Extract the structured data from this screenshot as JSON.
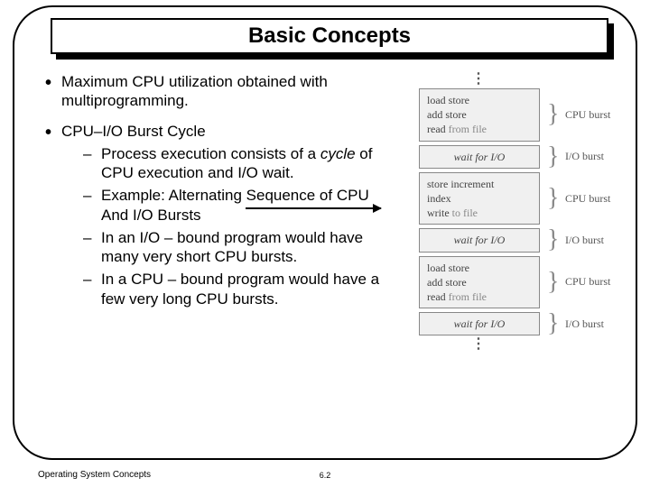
{
  "title": "Basic Concepts",
  "bullets": [
    {
      "text": "Maximum CPU utilization obtained with multiprogramming."
    },
    {
      "text": "CPU–I/O Burst Cycle",
      "sub": [
        {
          "pre": "Process execution consists of a ",
          "em": "cycle",
          "post": " of CPU execution and I/O wait."
        },
        {
          "pre": "Example: Alternating Sequence of CPU And I/O Bursts"
        },
        {
          "pre": "In an I/O – bound program would have many very short CPU bursts."
        },
        {
          "pre": "In a CPU – bound program would have a few very long CPU bursts."
        }
      ]
    }
  ],
  "diagram": {
    "vdots": "⋮",
    "cpu_label": "CPU burst",
    "io_label": "I/O burst",
    "wait": "wait for I/O",
    "block1": {
      "l1a": "load store",
      "l2a": "add store",
      "l3a": "read ",
      "l3b": "from file"
    },
    "block2": {
      "l1a": "store increment",
      "l2a": "index",
      "l3a": "write ",
      "l3b": "to file"
    },
    "block3": {
      "l1a": "load store",
      "l2a": "add store",
      "l3a": "read ",
      "l3b": "from file"
    }
  },
  "footer": {
    "left": "Operating System Concepts",
    "center": "6.2"
  }
}
